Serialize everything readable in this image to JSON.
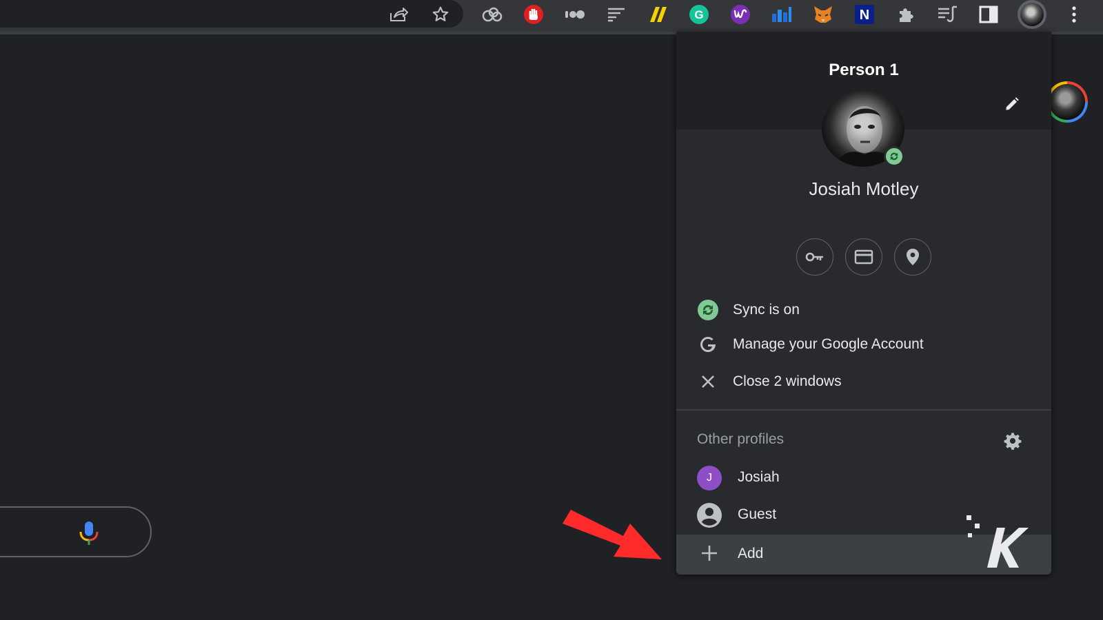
{
  "toolbar": {
    "icons": [
      "share-icon",
      "bookmark-star-icon"
    ],
    "extensions": [
      "cloud-extension-icon",
      "adblock-hand-icon",
      "dots-extension-icon",
      "lines-extension-icon",
      "yellow-slash-extension-icon",
      "grammarly-icon",
      "purple-w-extension-icon",
      "chart-extension-icon",
      "metamask-fox-icon",
      "notion-n-icon",
      "puzzle-extensions-icon",
      "reading-list-icon",
      "side-panel-icon"
    ],
    "notion_letter": "N",
    "grammarly_letter": "G",
    "accent": "#81c995"
  },
  "profile_menu": {
    "title": "Person 1",
    "user_name": "Josiah Motley",
    "quick_actions": [
      "passwords-key-icon",
      "payment-card-icon",
      "addresses-pin-icon"
    ],
    "items": {
      "sync": "Sync is on",
      "manage": "Manage your Google Account",
      "close": "Close 2 windows"
    },
    "other_profiles_title": "Other profiles",
    "profiles": {
      "josiah": {
        "label": "Josiah",
        "initial": "J",
        "color": "#8e4ec6"
      },
      "guest": {
        "label": "Guest"
      }
    },
    "add_label": "Add"
  },
  "colors": {
    "background": "#202124",
    "menu": "#292a2d",
    "sync_green": "#81c995",
    "arrow_red": "#ff2a2a"
  }
}
